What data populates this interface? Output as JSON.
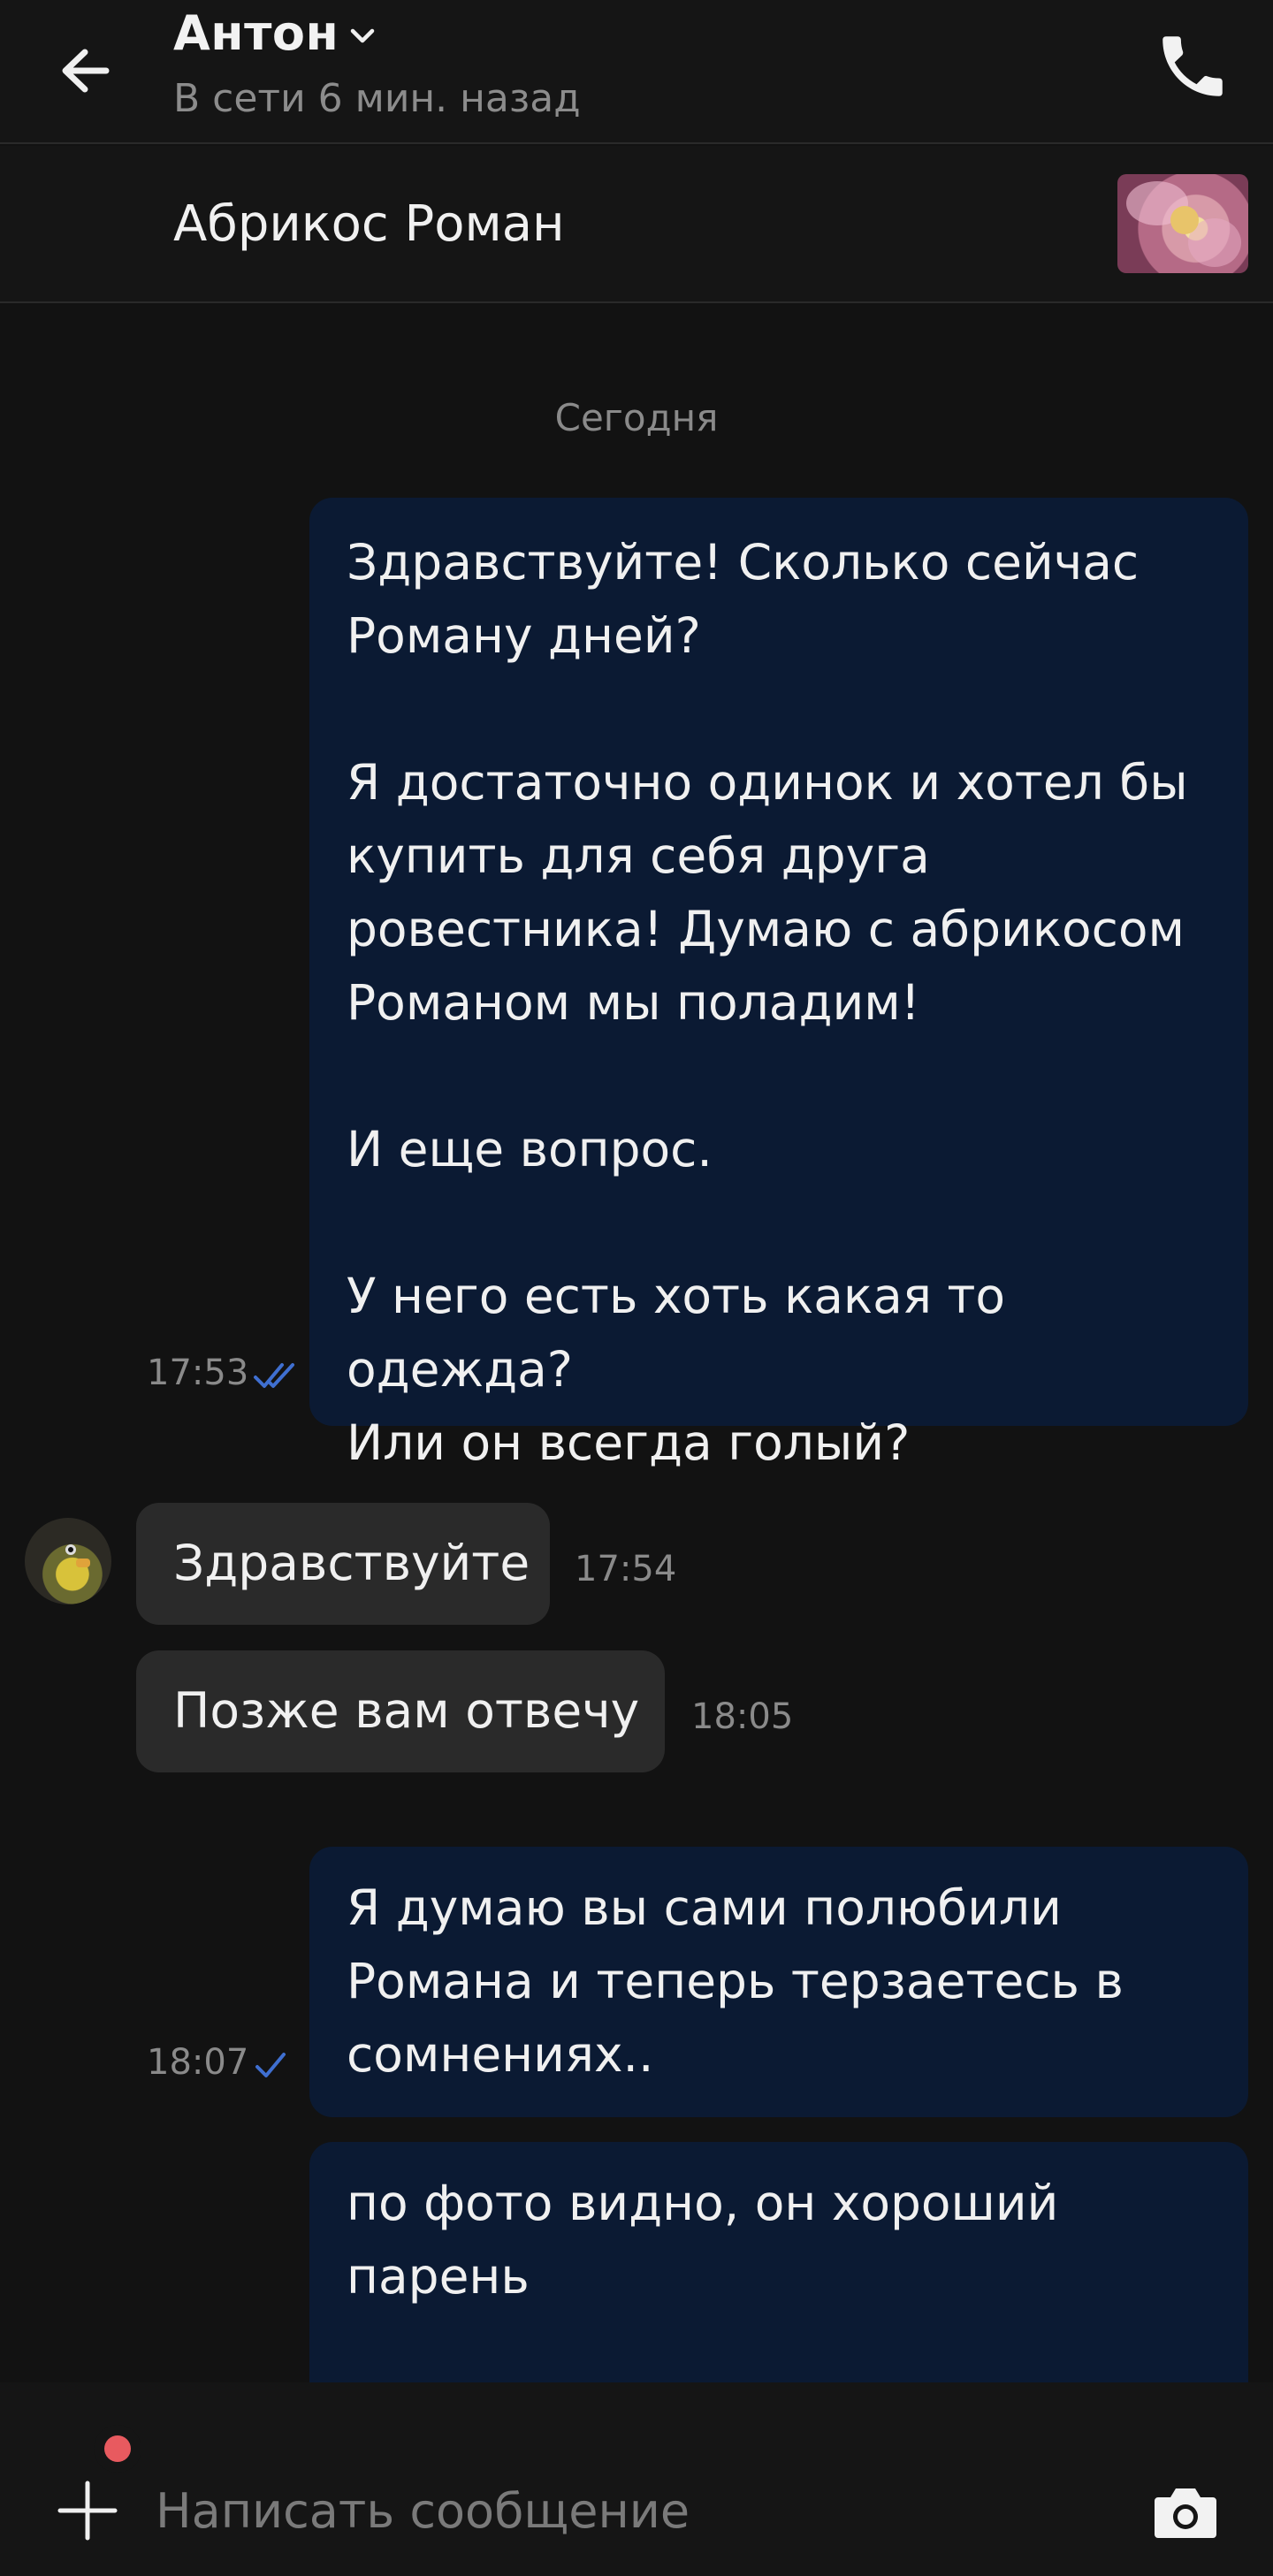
{
  "header": {
    "contact_name": "Антон",
    "presence": "В сети 6 мин. назад",
    "icons": {
      "back": "arrow-left-icon",
      "expand": "chevron-down-icon",
      "call": "phone-icon"
    }
  },
  "product": {
    "title": "Абрикос Роман",
    "thumbnail": "product-photo"
  },
  "chat": {
    "date_separator": "Сегодня",
    "messages": [
      {
        "direction": "out",
        "text": "Здравствуйте! Сколько сейчас\nРоману дней?\n\nЯ достаточно одинок и хотел бы\nкупить для себя друга\nровестника! Думаю с абрикосом\nРоманом мы поладим!\n\nИ еще вопрос.\n\nУ него есть хоть какая то одежда?\nИли он всегда голый?",
        "time": "17:53",
        "status": "read"
      },
      {
        "direction": "in",
        "text": "Здравствуйте",
        "time": "17:54"
      },
      {
        "direction": "in",
        "text": "Позже вам отвечу",
        "time": "18:05"
      },
      {
        "direction": "out",
        "text": "Я думаю вы сами полюбили\nРомана и теперь терзаетесь в\nсомнениях..",
        "time": "18:07",
        "status": "sent"
      },
      {
        "direction": "out",
        "text": "по фото видно, он хороший\nпарень",
        "time": "",
        "status": ""
      }
    ]
  },
  "composer": {
    "placeholder": "Написать сообщение",
    "value": "",
    "icons": {
      "attach": "plus-icon",
      "camera": "camera-icon"
    },
    "colors": {
      "notification_dot": "#e85a5f"
    }
  },
  "colors": {
    "background": "#121212",
    "outgoing_bubble": "#0b1a33",
    "incoming_bubble": "#2a2a2a",
    "check_mark": "#3f6fd0"
  }
}
